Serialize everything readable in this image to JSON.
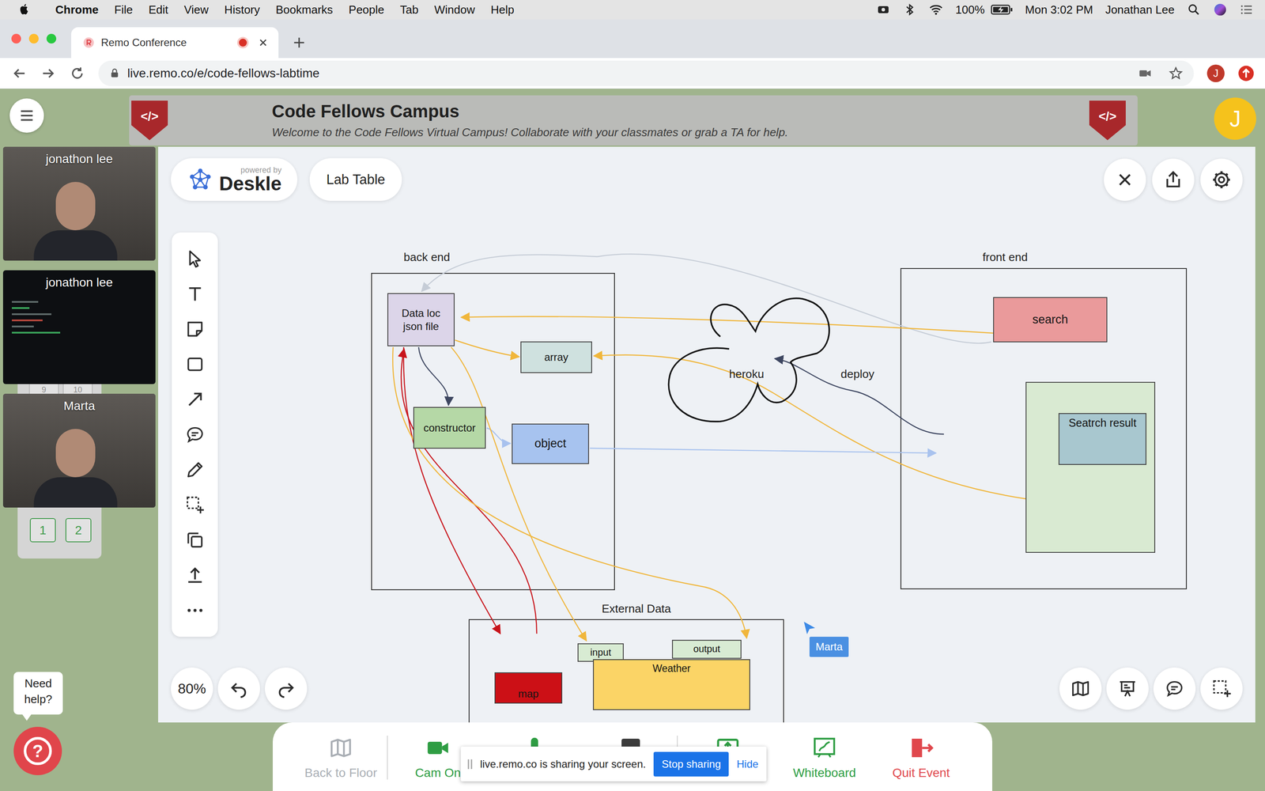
{
  "menubar": {
    "app": "Chrome",
    "menus": [
      "File",
      "Edit",
      "View",
      "History",
      "Bookmarks",
      "People",
      "Tab",
      "Window",
      "Help"
    ],
    "battery": "100%",
    "charging": true,
    "clock": "Mon 3:02 PM",
    "user": "Jonathan Lee"
  },
  "browser": {
    "tab": {
      "title": "Remo Conference",
      "selected": true,
      "recording": true
    },
    "url": "live.remo.co/e/code-fellows-labtime",
    "profile": "J"
  },
  "header": {
    "logo": "</>",
    "title": "Code Fellows Campus",
    "subtitle": "Welcome to the Code Fellows Virtual Campus! Collaborate with your classmates or grab a TA for help.",
    "avatar": "J"
  },
  "participants": [
    {
      "name": "jonathon lee",
      "kind": "camera"
    },
    {
      "name": "jonathon lee",
      "kind": "screen"
    },
    {
      "name": "Marta",
      "kind": "camera"
    }
  ],
  "tables": {
    "partly_hidden": [
      "9",
      "10"
    ],
    "numbers": [
      "1",
      "2"
    ]
  },
  "help": {
    "label": "Need help?",
    "icon": "?"
  },
  "whiteboard": {
    "powered_by": "powered by",
    "brand": "Deskle",
    "board": "Lab Table",
    "zoom": "80%",
    "tools": [
      {
        "kind": "select",
        "selected": false
      },
      {
        "kind": "text",
        "selected": false
      },
      {
        "kind": "sticky",
        "selected": false
      },
      {
        "kind": "rect",
        "selected": false
      },
      {
        "kind": "arrow",
        "selected": false
      },
      {
        "kind": "comment",
        "selected": false
      },
      {
        "kind": "pen",
        "selected": false
      },
      {
        "kind": "frame",
        "selected": false
      },
      {
        "kind": "copy",
        "selected": false
      },
      {
        "kind": "upload",
        "selected": false
      },
      {
        "kind": "more",
        "selected": false
      }
    ],
    "top_actions": [
      {
        "kind": "close"
      },
      {
        "kind": "share"
      },
      {
        "kind": "settings"
      }
    ],
    "bottom_actions": [
      {
        "kind": "map"
      },
      {
        "kind": "present"
      },
      {
        "kind": "chat"
      },
      {
        "kind": "select-area"
      }
    ]
  },
  "diagram": {
    "groups": [
      {
        "label": "back end"
      },
      {
        "label": "front end"
      },
      {
        "label": "External Data"
      }
    ],
    "nodes": [
      {
        "text": "Data loc json file",
        "color": "#dcd5e9"
      },
      {
        "text": "array",
        "color": "#cfe1df"
      },
      {
        "text": "constructor",
        "color": "#b5d8a6"
      },
      {
        "text": "object",
        "color": "#a7c3ef"
      },
      {
        "text": "search",
        "color": "#ea9a9b"
      },
      {
        "text": "Seatrch result",
        "color": "#a8c7cf"
      },
      {
        "text": "input",
        "color": "#d8ebd3"
      },
      {
        "text": "output",
        "color": "#d8ebd3"
      },
      {
        "text": "Weather",
        "color": "#fbd466"
      },
      {
        "text": "map",
        "color": "#cc1016"
      }
    ],
    "cloud": {
      "label": "heroku"
    },
    "edge_label": "deploy",
    "cursor": {
      "user": "Marta"
    }
  },
  "toolbar": {
    "items": [
      {
        "label": "Back to Floor",
        "kind": "floor",
        "disabled": true
      },
      {
        "label": "Cam On",
        "kind": "camera",
        "disabled": false,
        "color": "#2e9d43"
      },
      {
        "kind": "mic",
        "disabled": false,
        "color": "#2e9d43"
      },
      {
        "kind": "chat",
        "disabled": false,
        "color": "#3c3c3c"
      },
      {
        "kind": "share",
        "disabled": false,
        "color": "#2e9d43"
      },
      {
        "label": "Whiteboard",
        "kind": "whiteboard",
        "disabled": false,
        "color": "#2e9d43"
      },
      {
        "label": "Quit Event",
        "kind": "quit",
        "disabled": false,
        "color": "#e0474c"
      }
    ]
  },
  "share_banner": {
    "text": "live.remo.co is sharing your screen.",
    "stop": "Stop sharing",
    "hide": "Hide"
  }
}
